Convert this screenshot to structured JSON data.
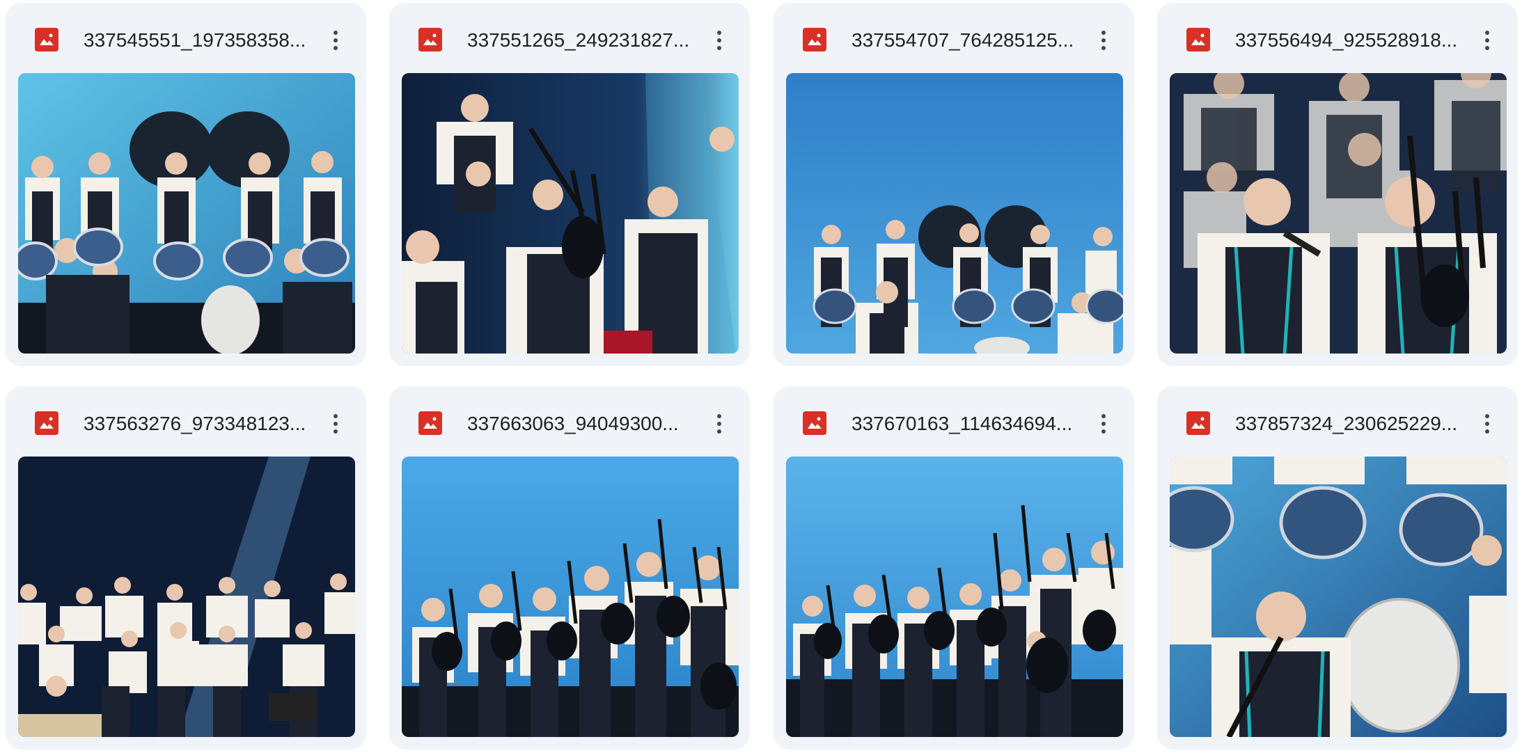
{
  "files": [
    {
      "name": "337545551_197358358...",
      "icon": "image-file-icon",
      "thumb": "drum-corps-blue-bg"
    },
    {
      "name": "337551265_249231827...",
      "icon": "image-file-icon",
      "thumb": "bagpiper-spotlight-dark"
    },
    {
      "name": "337554707_764285125...",
      "icon": "image-file-icon",
      "thumb": "drummers-wide-blue"
    },
    {
      "name": "337556494_925528918...",
      "icon": "image-file-icon",
      "thumb": "bagpipe-and-bombarde-closeup"
    },
    {
      "name": "337563276_973348123...",
      "icon": "image-file-icon",
      "thumb": "bombarde-players-dark-stage"
    },
    {
      "name": "337663063_94049300...",
      "icon": "image-file-icon",
      "thumb": "pipers-line-blue"
    },
    {
      "name": "337670163_114634694...",
      "icon": "image-file-icon",
      "thumb": "pipers-group-blue"
    },
    {
      "name": "337857324_230625229...",
      "icon": "image-file-icon",
      "thumb": "bombarde-and-bass-drum"
    }
  ],
  "colors": {
    "card_bg": "#f0f4f9",
    "icon_red": "#d93025",
    "text": "#1f1f1f",
    "kebab": "#444746"
  }
}
